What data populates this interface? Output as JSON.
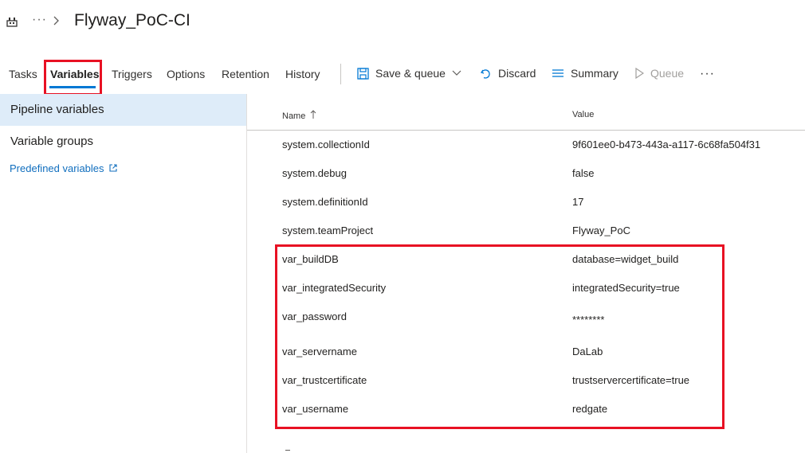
{
  "header": {
    "breadcrumb_ellipsis": "···",
    "title": "Flyway_PoC-CI"
  },
  "toolbar": {
    "tabs": [
      {
        "label": "Tasks"
      },
      {
        "label": "Variables"
      },
      {
        "label": "Triggers"
      },
      {
        "label": "Options"
      },
      {
        "label": "Retention"
      },
      {
        "label": "History"
      }
    ],
    "save_queue_label": "Save & queue",
    "discard_label": "Discard",
    "summary_label": "Summary",
    "queue_label": "Queue",
    "more_label": "···"
  },
  "sidebar": {
    "items": [
      {
        "label": "Pipeline variables"
      },
      {
        "label": "Variable groups"
      }
    ],
    "predefined_link": "Predefined variables"
  },
  "grid": {
    "columns": {
      "name": "Name",
      "value": "Value"
    },
    "rows": [
      {
        "name": "system.collectionId",
        "value": "9f601ee0-b473-443a-a117-6c68fa504f31"
      },
      {
        "name": "system.debug",
        "value": "false"
      },
      {
        "name": "system.definitionId",
        "value": "17"
      },
      {
        "name": "system.teamProject",
        "value": "Flyway_PoC"
      },
      {
        "name": "var_buildDB",
        "value": "database=widget_build"
      },
      {
        "name": "var_integratedSecurity",
        "value": "integratedSecurity=true"
      },
      {
        "name": "var_password",
        "value": "********"
      },
      {
        "name": "var_servername",
        "value": "DaLab"
      },
      {
        "name": "var_trustcertificate",
        "value": "trustservercertificate=true"
      },
      {
        "name": "var_username",
        "value": "redgate"
      }
    ]
  },
  "colors": {
    "accent": "#0078d4",
    "highlight_box": "#e81123",
    "selected_bg": "#deecf9",
    "link": "#106ebe"
  }
}
